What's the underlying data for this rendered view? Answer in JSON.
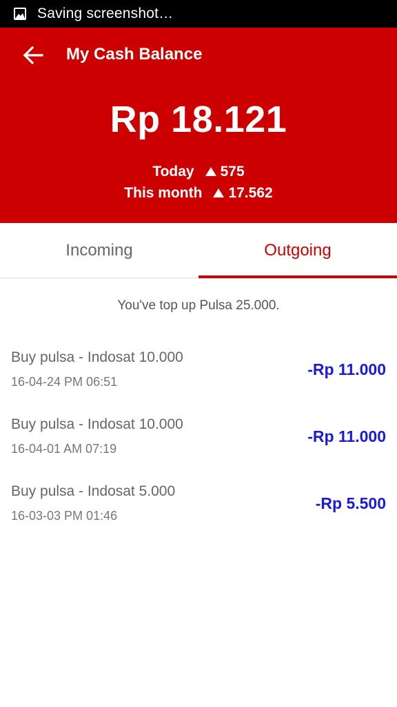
{
  "status_bar": {
    "icon": "image-icon",
    "text": "Saving screenshot…"
  },
  "header": {
    "back_icon": "arrow-left-icon",
    "title": "My Cash Balance",
    "balance": "Rp 18.121",
    "today_label": "Today",
    "today_value": "575",
    "month_label": "This month",
    "month_value": "17.562",
    "trend_icon": "triangle-up-icon"
  },
  "tabs": [
    {
      "label": "Incoming",
      "active": false
    },
    {
      "label": "Outgoing",
      "active": true
    }
  ],
  "notice": "You've top up Pulsa 25.000.",
  "transactions": [
    {
      "title": "Buy pulsa - Indosat 10.000",
      "date": "16-04-24  PM 06:51",
      "amount": "-Rp 11.000"
    },
    {
      "title": "Buy pulsa - Indosat 10.000",
      "date": "16-04-01  AM 07:19",
      "amount": "-Rp 11.000"
    },
    {
      "title": "Buy pulsa - Indosat 5.000",
      "date": "16-03-03  PM 01:46",
      "amount": "-Rp 5.500"
    }
  ],
  "colors": {
    "brand_red": "#cc0000",
    "amount_blue": "#1a1adb",
    "status_bar": "#000000"
  }
}
